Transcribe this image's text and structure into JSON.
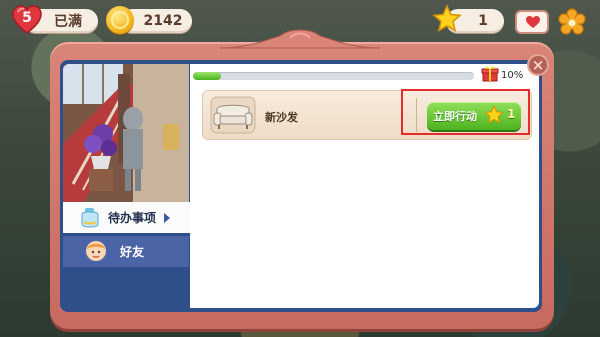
{
  "hud": {
    "lives_count": "5",
    "lives_status": "已满",
    "coins": "2142",
    "stars": "1"
  },
  "panel": {
    "progress_percent": 10,
    "progress_text": "10%",
    "tabs": [
      {
        "label": "待办事项",
        "active": true
      },
      {
        "label": "好友",
        "active": false
      }
    ],
    "tasks": [
      {
        "name": "新沙发",
        "action_label": "立即行动",
        "cost": "1",
        "icon": "sofa-icon"
      }
    ]
  },
  "colors": {
    "panel_frame": "#d98578",
    "sidebar_blue": "#2f4f8a",
    "action_green": "#4eb31e",
    "highlight_red": "#e32d2d"
  }
}
